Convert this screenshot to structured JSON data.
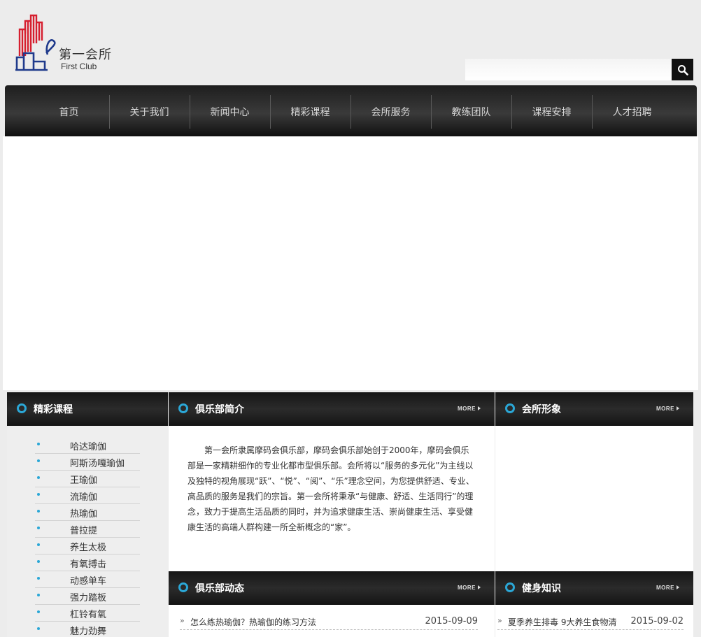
{
  "header": {
    "logo_cn": "第一会所",
    "logo_en": "First Club",
    "search_placeholder": ""
  },
  "nav": {
    "items": [
      "首页",
      "关于我们",
      "新闻中心",
      "精彩课程",
      "会所服务",
      "教练团队",
      "课程安排",
      "人才招聘"
    ]
  },
  "courses": {
    "title": "精彩课程",
    "items": [
      "哈达瑜伽",
      "阿斯汤嘎瑜伽",
      "王瑜伽",
      "流瑜伽",
      "热瑜伽",
      "普拉提",
      "养生太极",
      "有氧搏击",
      "动感单车",
      "强力踏板",
      "杠铃有氧",
      "魅力劲舞"
    ]
  },
  "intro": {
    "title": "俱乐部简介",
    "more": "MORE",
    "text": "第一会所隶属摩码会俱乐部，摩码会俱乐部始创于2000年，摩码会俱乐部是一家精耕细作的专业化都市型俱乐部。会所将以“服务的多元化”为主线以及独特的视角展现“跃”、“悦”、“阅”、“乐”理念空间，为您提供舒适、专业、高品质的服务是我们的宗旨。第一会所将秉承“与健康、舒适、生活同行”的理念，致力于提高生活品质的同时，并为追求健康生活、崇尚健康生活、享受健康生活的高端人群构建一所全新概念的“家”。"
  },
  "image_panel": {
    "title": "会所形象",
    "more": "MORE"
  },
  "news": {
    "title": "俱乐部动态",
    "more": "MORE",
    "items": [
      {
        "title": "怎么练热瑜伽？热瑜伽的练习方法",
        "date": "2015-09-09"
      }
    ]
  },
  "knowledge": {
    "title": "健身知识",
    "more": "MORE",
    "items": [
      {
        "title": "夏季养生排毒 9大养生食物清",
        "date": "2015-09-02"
      }
    ]
  },
  "colors": {
    "accent": "#2ba7d6",
    "nav_dark": "#1e1e1e",
    "logo_red": "#d61f2f",
    "logo_blue": "#1f3a8c"
  }
}
